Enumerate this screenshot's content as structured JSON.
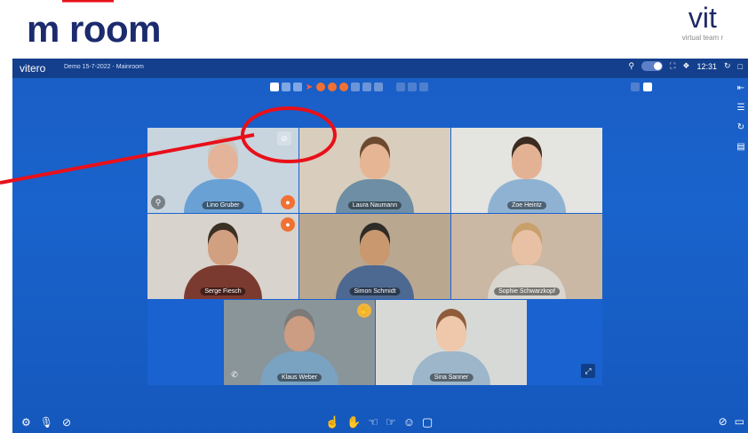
{
  "slide": {
    "title": "m room",
    "logo": {
      "main": "vit",
      "sub": "virtual team r"
    }
  },
  "app": {
    "brand": "vitero",
    "session": "Demo 15-7-2022 - Mainroom",
    "clock": "12:31",
    "toolbar_icons": [
      "image-icon",
      "camera-icon",
      "screen-icon",
      "pointer-icon",
      "record-icon",
      "settings-icon",
      "stop-icon",
      "marker-icon",
      "grid-icon",
      "star-icon",
      "camera-off-icon",
      "emoji-icon",
      "chat-icon"
    ],
    "side_icons": [
      "collapse-icon",
      "list-icon",
      "refresh-icon",
      "save-icon"
    ]
  },
  "participants": [
    {
      "name": "Lino Gruber",
      "skin": "#e4b49a",
      "hair": "#c9c7c2",
      "shirt": "#6aa1d4",
      "bg": "#c8d5df"
    },
    {
      "name": "Laura Naumann",
      "skin": "#e6b593",
      "hair": "#6b4a30",
      "shirt": "#6d8ea4",
      "bg": "#d9cdbd"
    },
    {
      "name": "Zoe Heintz",
      "skin": "#e3b295",
      "hair": "#3a2a20",
      "shirt": "#8fb2d3",
      "bg": "#e4e4e0"
    },
    {
      "name": "Serge Fiesch",
      "skin": "#d1a080",
      "hair": "#3b3024",
      "shirt": "#7b3a30",
      "bg": "#d8d3cc"
    },
    {
      "name": "Simon Schmidt",
      "skin": "#c9986f",
      "hair": "#2f2b27",
      "shirt": "#4e6991",
      "bg": "#b9a78f"
    },
    {
      "name": "Sophie Schwarzkopf",
      "skin": "#e8c0a4",
      "hair": "#c99f6b",
      "shirt": "#d9d5cf",
      "bg": "#cab7a4"
    },
    {
      "name": "Klaus Weber",
      "skin": "#cc9d83",
      "hair": "#7c7b79",
      "shirt": "#7aa2c1",
      "bg": "#8a959a"
    },
    {
      "name": "Sina Sanner",
      "skin": "#efc7aa",
      "hair": "#8f5b3a",
      "shirt": "#9db6c9",
      "bg": "#d7d9d7"
    }
  ],
  "bottom": {
    "left": [
      "gear-icon",
      "mic-icon",
      "camera-off-icon"
    ],
    "center": [
      "hand-raise-icon",
      "hand-wave-icon",
      "thumb-up-icon",
      "thumb-down-icon",
      "smiley-icon",
      "chat-icon"
    ],
    "right": [
      "mute-pointer-icon",
      "screen-share-icon"
    ]
  },
  "colors": {
    "accent": "#1963cc",
    "annotation": "#e8101a"
  }
}
